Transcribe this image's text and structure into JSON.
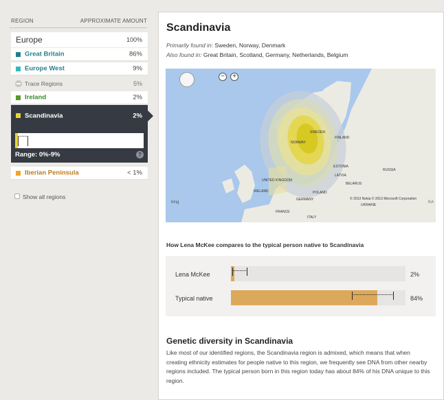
{
  "sidebar": {
    "header_region": "REGION",
    "header_amount": "APPROXIMATE AMOUNT",
    "europe": {
      "label": "Europe",
      "value": "100%"
    },
    "items": [
      {
        "label": "Great Britain",
        "value": "86%",
        "color": "#1e7f8c"
      },
      {
        "label": "Europe West",
        "value": "9%",
        "color": "#33b8bd"
      },
      {
        "label": "Trace Regions",
        "value": "5%"
      },
      {
        "label": "Ireland",
        "value": "2%",
        "color": "#5b9a2a"
      },
      {
        "label": "Scandinavia",
        "value": "2%",
        "color": "#e9d430"
      },
      {
        "label": "Iberian Peninsula",
        "value": "< 1%",
        "color": "#f2a32a"
      }
    ],
    "selected": {
      "range_text": "Range: 0%-9%",
      "help_icon": "?"
    },
    "show_all": "Show all regions"
  },
  "detail": {
    "title": "Scandinavia",
    "primary_prefix": "Primarily found in:",
    "primary_value": "Sweden, Norway, Denmark",
    "also_prefix": "Also found in:",
    "also_value": "Great Britain, Scotland, Germany, Netherlands, Belgium",
    "map": {
      "zoom_out_icon": "zoom-out-icon",
      "zoom_in_icon": "zoom-in-icon",
      "labels": {
        "sweden": "SWEDEN",
        "norway": "NORWAY",
        "finland": "FINLAND",
        "estonia": "ESTONIA",
        "latvia": "LATVIA",
        "ireland": "IRELAND",
        "poland": "POLAND",
        "united_kingdom": "UNITED KINGDOM",
        "france": "FRANCE",
        "germany": "GERMANY",
        "italy": "ITALY",
        "belarus": "BELARUS",
        "ukraine": "UKRAINE",
        "russia": "RUSSIA",
        "ka": "KA"
      },
      "copyright": "© 2013 Nokia   © 2013 Microsoft Corporation",
      "bing": "bing"
    },
    "compare_title": "How Lena McKee compares to the typical person native to Scandinavia",
    "compare": [
      {
        "label": "Lena McKee",
        "value": "2%",
        "fill_pct": 2
      },
      {
        "label": "Typical native",
        "value": "84%",
        "fill_pct": 84
      }
    ],
    "diversity_title": "Genetic diversity in Scandinavia",
    "diversity_text": "Like most of our identified regions, the Scandinavia region is admixed, which means that when creating ethnicity estimates for people native to this region, we frequently see DNA from other nearby regions included. The typical person born in this region today has about 84% of his DNA unique to this region."
  },
  "colors": {
    "selected_bg": "#363a42",
    "compare_fill": "#dca95c",
    "map_water": "#a9c8ec"
  }
}
